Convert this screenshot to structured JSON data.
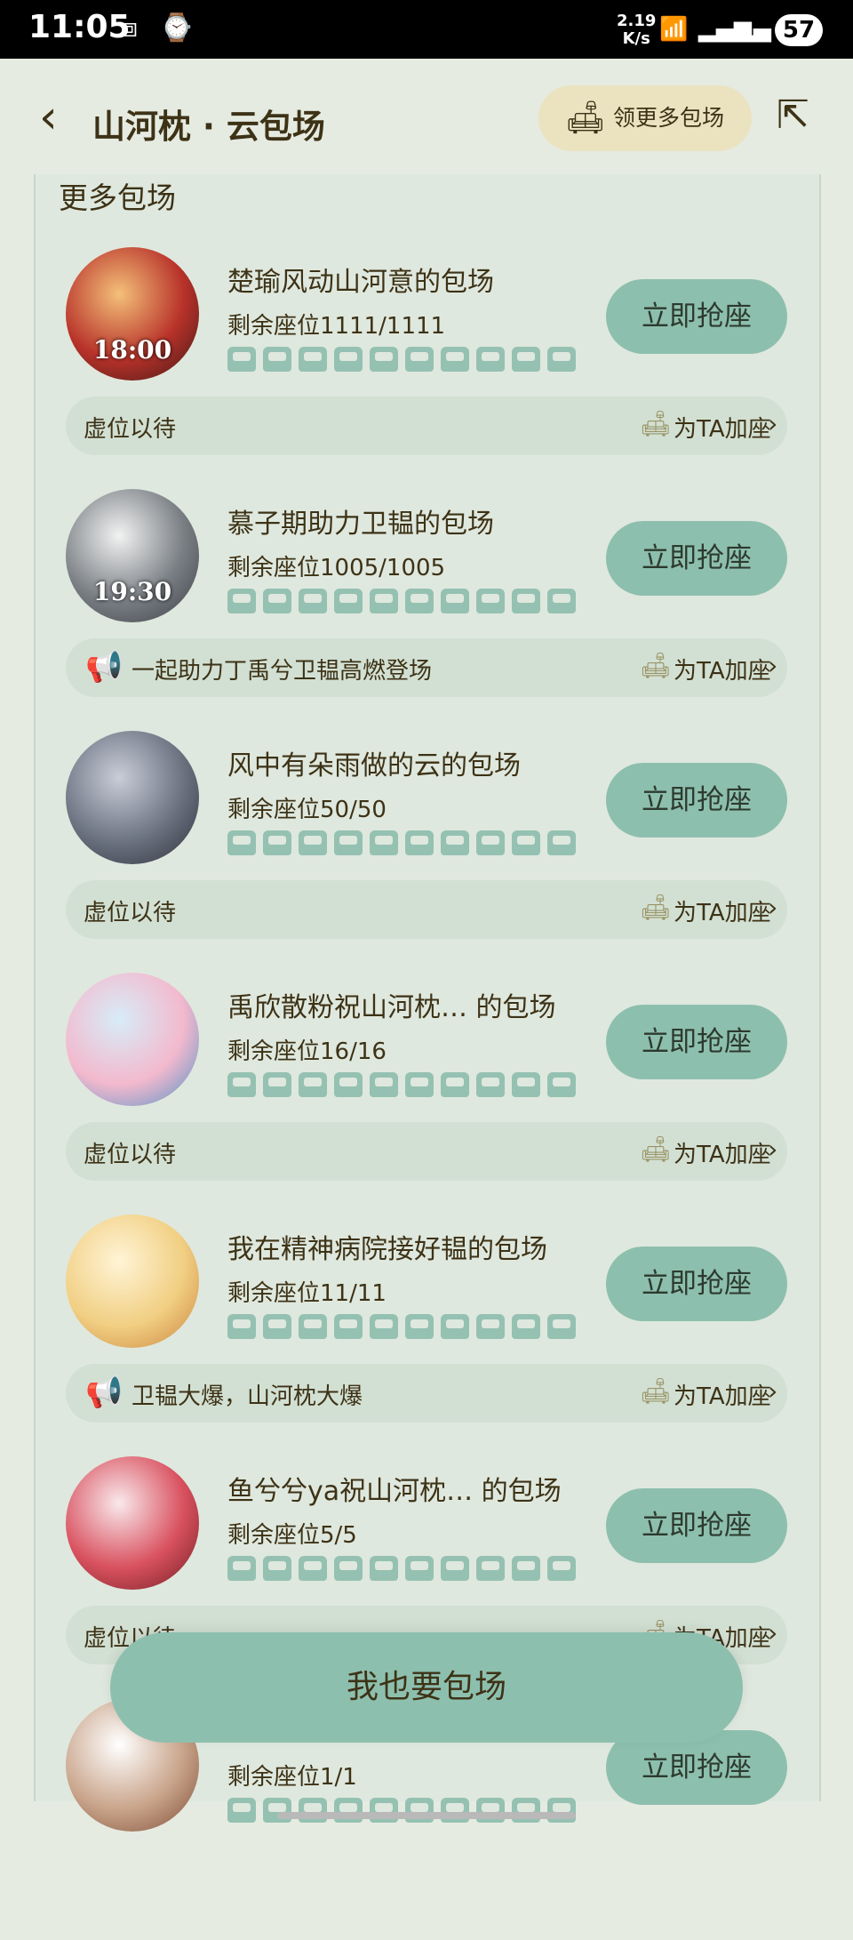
{
  "status_bar": {
    "time": "11:05",
    "speed_value": "2.19",
    "speed_unit": "K/s",
    "battery": "57"
  },
  "header": {
    "title": "山河枕 · 云包场",
    "more_button_label": "领更多包场"
  },
  "section_title": "更多包场",
  "seat_label": "为TA加座",
  "grab_label": "立即抢座",
  "items": [
    {
      "title": "楚瑜风动山河意的包场",
      "seats": "剩余座位1111/1111",
      "time": "18:00",
      "note": "虚位以待",
      "has_note_icon": false,
      "avatar_colors": [
        "#f4c079",
        "#b8322a",
        "#3b1715"
      ]
    },
    {
      "title": "慕子期助力卫韫的包场",
      "seats": "剩余座位1005/1005",
      "time": "19:30",
      "note": "一起助力丁禹兮卫韫高燃登场",
      "has_note_icon": true,
      "avatar_colors": [
        "#f2f2f2",
        "#7a7f84",
        "#3c3f46"
      ]
    },
    {
      "title": "风中有朵雨做的云的包场",
      "seats": "剩余座位50/50",
      "time": "",
      "note": "虚位以待",
      "has_note_icon": false,
      "avatar_colors": [
        "#c8cdd8",
        "#6b7280",
        "#2b2f38"
      ]
    },
    {
      "title": "禹欣散粉祝山河枕…  的包场",
      "seats": "剩余座位16/16",
      "time": "",
      "note": "虚位以待",
      "has_note_icon": false,
      "avatar_colors": [
        "#d7ecf8",
        "#f3b9cd",
        "#4a90c8"
      ]
    },
    {
      "title": "我在精神病院接好韫的包场",
      "seats": "剩余座位11/11",
      "time": "",
      "note": "卫韫大爆，山河枕大爆",
      "has_note_icon": true,
      "avatar_colors": [
        "#fff4d6",
        "#f1cf83",
        "#c9823b"
      ]
    },
    {
      "title": "鱼兮兮ya祝山河枕…  的包场",
      "seats": "剩余座位5/5",
      "time": "",
      "note": "虚位以待",
      "has_note_icon": false,
      "avatar_colors": [
        "#f9e9ec",
        "#d9515f",
        "#6c1d22"
      ]
    },
    {
      "title": "",
      "seats": "剩余座位1/1",
      "time": "",
      "note": "",
      "has_note_icon": false,
      "avatar_colors": [
        "#ffffff",
        "#c9a48a",
        "#7a4a34"
      ]
    }
  ],
  "bottom_button_label": "我也要包场"
}
